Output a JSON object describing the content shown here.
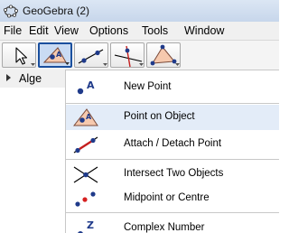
{
  "window": {
    "title": "GeoGebra (2)",
    "icon": "geogebra-logo-icon"
  },
  "menubar": {
    "items": [
      "File",
      "Edit",
      "View",
      "Options",
      "Tools",
      "Window"
    ]
  },
  "toolbar": {
    "tools": [
      {
        "name": "move",
        "icon": "move-arrow-icon"
      },
      {
        "name": "point",
        "icon": "point-on-object-icon",
        "active": true
      },
      {
        "name": "line",
        "icon": "line-through-points-icon"
      },
      {
        "name": "perpendicular",
        "icon": "perpendicular-line-icon"
      },
      {
        "name": "polygon",
        "icon": "polygon-icon"
      }
    ]
  },
  "algebra_view": {
    "label": "Alge"
  },
  "dropdown": {
    "items": [
      {
        "label": "New Point",
        "icon": "new-point-icon"
      },
      {
        "label": "Point on Object",
        "icon": "point-on-object-icon",
        "selected": true
      },
      {
        "label": "Attach / Detach Point",
        "icon": "attach-detach-point-icon"
      },
      {
        "label": "Intersect Two Objects",
        "icon": "intersect-icon"
      },
      {
        "label": "Midpoint or Centre",
        "icon": "midpoint-icon"
      },
      {
        "label": "Complex Number",
        "icon": "complex-number-icon"
      }
    ]
  },
  "colors": {
    "accent": "#1a4f9e",
    "selection": "#e3ecf8",
    "point_blue": "#1f3a8a",
    "point_red": "#d62020"
  }
}
